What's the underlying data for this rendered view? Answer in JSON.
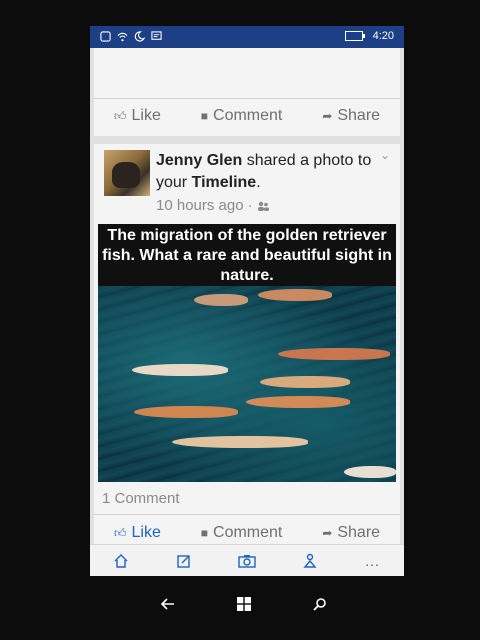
{
  "status_bar": {
    "time": "4:20"
  },
  "top_card": {
    "actions": {
      "like": "Like",
      "comment": "Comment",
      "share": "Share"
    }
  },
  "post": {
    "author": "Jenny Glen",
    "action_text": "shared a photo to your",
    "target": "Timeline",
    "target_suffix": ".",
    "time": "10 hours ago",
    "separator": "·",
    "caption": "The migration of the golden retriever fish. What a rare and beautiful sight in nature.",
    "comments_count": "1 Comment",
    "actions": {
      "like": "Like",
      "comment": "Comment",
      "share": "Share"
    }
  },
  "app_bar": {
    "more": "..."
  },
  "colors": {
    "status_bar": "#1d3f86",
    "accent": "#1f64c0",
    "muted_text": "#8a8a8a"
  },
  "icons": [
    "notification-icon",
    "wifi-icon",
    "do-not-disturb-icon",
    "message-icon",
    "battery-icon",
    "thumbs-up-icon",
    "comment-icon",
    "share-icon",
    "audience-friends-icon",
    "chevron-down-icon",
    "home-icon",
    "compose-icon",
    "camera-icon",
    "find-friends-icon",
    "back-icon",
    "windows-start-icon",
    "search-icon"
  ]
}
